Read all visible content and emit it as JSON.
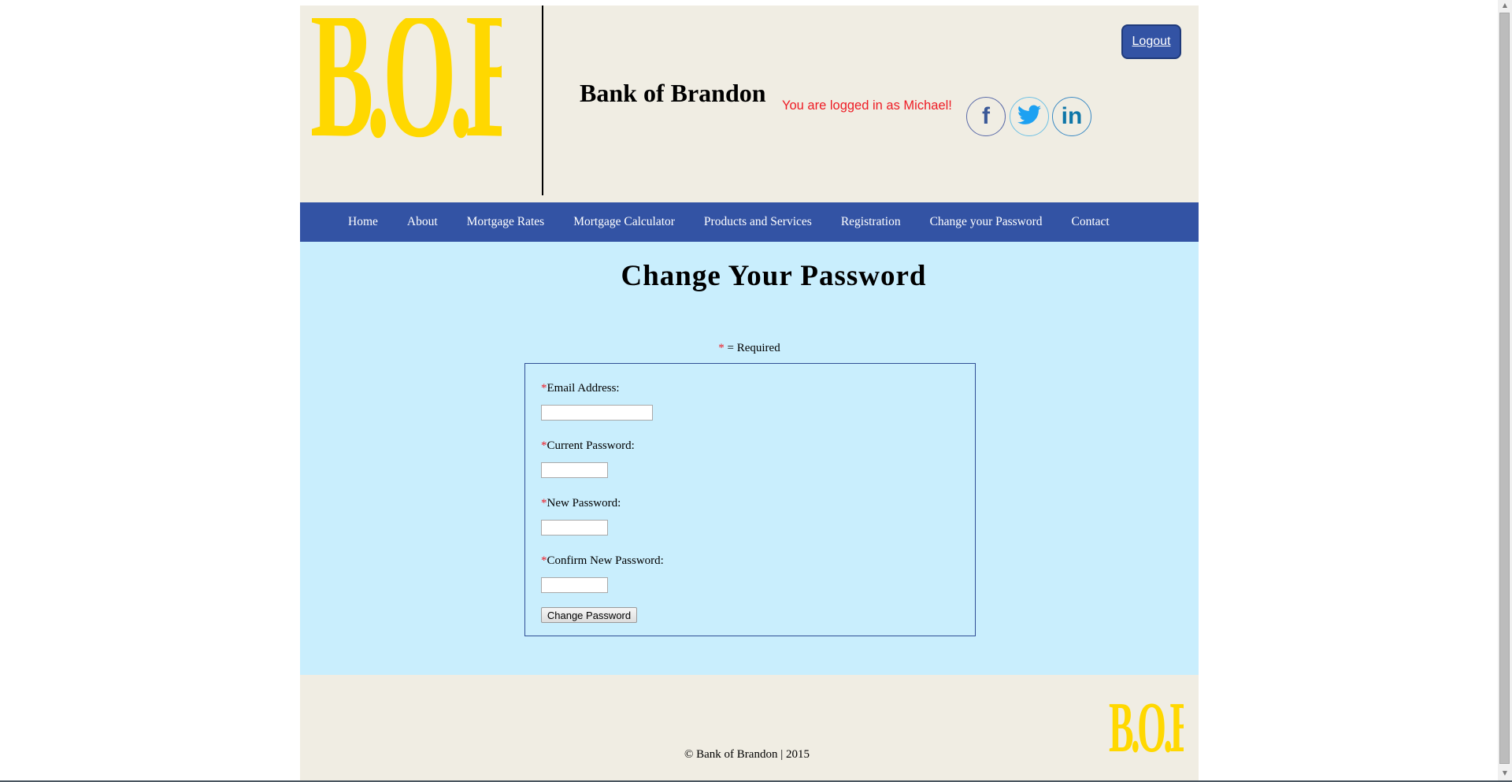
{
  "header": {
    "logo_text": "B.O.B",
    "bank_name": "Bank of Brandon",
    "logged_in_message": "You are logged in as Michael!",
    "logout_label": "Logout",
    "social": [
      {
        "name": "facebook-icon",
        "glyph": "f",
        "color": "#3b5998"
      },
      {
        "name": "twitter-icon",
        "glyph": "🐦",
        "color": "#1da1f2"
      },
      {
        "name": "linkedin-icon",
        "glyph": "in",
        "color": "#0e76a8"
      }
    ]
  },
  "nav": {
    "items": [
      {
        "label": "Home"
      },
      {
        "label": "About"
      },
      {
        "label": "Mortgage Rates"
      },
      {
        "label": "Mortgage Calculator"
      },
      {
        "label": "Products and Services"
      },
      {
        "label": "Registration"
      },
      {
        "label": "Change your Password"
      },
      {
        "label": "Contact"
      }
    ]
  },
  "main": {
    "title": "Change Your Password",
    "required_star": "*",
    "required_text": " = Required",
    "form": {
      "fields": [
        {
          "star": "*",
          "label": "Email Address:",
          "value": "",
          "type": "email"
        },
        {
          "star": "*",
          "label": "Current Password:",
          "value": "",
          "type": "password"
        },
        {
          "star": "*",
          "label": "New Password:",
          "value": "",
          "type": "password"
        },
        {
          "star": "*",
          "label": "Confirm New Password:",
          "value": "",
          "type": "password"
        }
      ],
      "submit_label": "Change Password"
    }
  },
  "footer": {
    "copyright": "© Bank of Brandon | 2015",
    "logo_text": "B.O.B"
  },
  "colors": {
    "brand_blue": "#3353a4",
    "brand_gold": "#ffd800",
    "header_bg": "#f0ede3",
    "content_bg": "#c9eefd",
    "alert_red": "#ee1b24"
  }
}
